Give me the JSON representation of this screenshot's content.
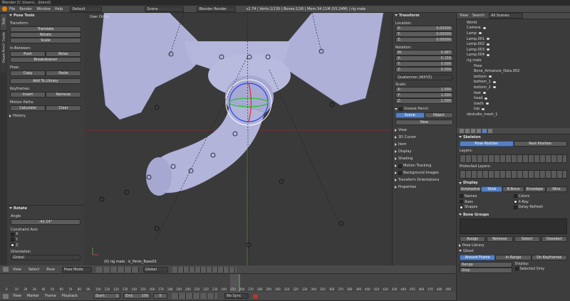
{
  "titlebar": {
    "text": "Blender [C:\\Users\\...\\blend]"
  },
  "topbar": {
    "menus": [
      "File",
      "Render",
      "Window",
      "Help"
    ],
    "layout": "Default",
    "scene": "Scene",
    "engine": "Blender Render",
    "stats": "v2.74 | Verts:1/130 | Bones:1/26 | Mem:34.11M (55.24M) | rig male"
  },
  "toolshelf": {
    "tabs": [
      "Tools",
      "Create",
      "Grease Pencil"
    ],
    "title": "Pose Tools",
    "transform_label": "Transform:",
    "translate": "Translate",
    "rotate": "Rotate",
    "scale": "Scale",
    "inbetweens_label": "In-Between:",
    "push": "Push",
    "relax": "Relax",
    "breakdowner": "Breakdowner",
    "pose_label": "Pose:",
    "copy": "Copy",
    "paste": "Paste",
    "add_to_library": "Add To Library",
    "keyframes_label": "Keyframes:",
    "insert": "Insert",
    "remove": "Remove",
    "motion_paths_label": "Motion Paths:",
    "calculate": "Calculate",
    "clear": "Clear",
    "history": "History"
  },
  "operator": {
    "title": "Rotate",
    "angle_label": "Angle",
    "angle_value": "-42.24°",
    "constraint_label": "Constraint Axis",
    "x": "X",
    "y": "Y",
    "z": "Z",
    "orientation_label": "Orientation",
    "orientation_value": "Global"
  },
  "viewport": {
    "view_name": "User Ortho",
    "status": "(0) rig male : b_Penis_Base01"
  },
  "nprops": {
    "transform_title": "Transform",
    "location_label": "Location:",
    "loc": [
      [
        "X:",
        "0.00000"
      ],
      [
        "Y:",
        "0.00000"
      ],
      [
        "Z:",
        "0.00000"
      ]
    ],
    "rotation_label": "Rotation:",
    "rot": [
      [
        "W:",
        "0.987"
      ],
      [
        "X:",
        "0.159"
      ],
      [
        "Y:",
        "0.000"
      ],
      [
        "Z:",
        "0.000"
      ]
    ],
    "rot_mode": "Quaternion (WXYZ)",
    "scale_label": "Scale:",
    "scl": [
      [
        "X:",
        "1.000"
      ],
      [
        "Y:",
        "1.000"
      ],
      [
        "Z:",
        "1.000"
      ]
    ],
    "grease_pencil": "Grease Pencil",
    "gp_scene": "Scene",
    "gp_object": "Object",
    "gp_new": "New",
    "sections": [
      "View",
      "3D Cursor",
      "Item",
      "Display",
      "Shading",
      "Motion Tracking",
      "Background Images",
      "Transform Orientations",
      "Properties"
    ]
  },
  "outliner": {
    "header": [
      "View",
      "Search",
      "All Scenes"
    ],
    "items": [
      "World",
      "Camera",
      "Lamp",
      "Lamp.001",
      "Lamp.002",
      "Lamp.003",
      "Lamp.004",
      "rig male",
      "Pose",
      "Bone_Armature_Data.002",
      "bottom",
      "bottom_1",
      "bottom_2",
      "feet",
      "head",
      "lowth",
      "top",
      "obstudio_mesh_1"
    ]
  },
  "properties": {
    "skeleton": "Skeleton",
    "pose_position": "Pose Position",
    "rest_position": "Rest Position",
    "layers": "Layers:",
    "protected_layers": "Protected Layers:",
    "display": "Display",
    "display_tabs": [
      "Octahedral",
      "Stick",
      "B-Bone",
      "Envelope",
      "Wire"
    ],
    "names": "Names",
    "colors": "Colors",
    "axes": "Axes",
    "xray": "X-Ray",
    "shapes": "Shapes",
    "delay_refresh": "Delay Refresh",
    "bone_groups": "Bone Groups",
    "assign": "Assign",
    "remove": "Remove",
    "select": "Select",
    "deselect": "Deselect",
    "pose_library": "Pose Library",
    "ghost": "Ghost",
    "ghost_tabs": [
      "Around Frame",
      "In Range",
      "On Keyframes"
    ],
    "range": "Range",
    "step": "Step",
    "display2": "Display:",
    "selected_only": "Selected Only"
  },
  "view3d_header": {
    "menus": [
      "View",
      "Select",
      "Pose"
    ],
    "mode": "Pose Mode",
    "pivot": "Global"
  },
  "timeline": {
    "menus": [
      "View",
      "Marker",
      "Frame",
      "Playback"
    ],
    "start_label": "Start:",
    "start": "1",
    "end_label": "End:",
    "end": "100",
    "current": "0",
    "sync": "No Sync",
    "ticks": [
      "0",
      "10",
      "20",
      "30",
      "40",
      "50",
      "60",
      "70",
      "80",
      "90",
      "100",
      "110",
      "120",
      "130",
      "140",
      "150",
      "160",
      "170",
      "180",
      "190",
      "200",
      "210",
      "220",
      "230",
      "240",
      "250",
      "260",
      "270",
      "280",
      "290",
      "300",
      "310",
      "320",
      "330",
      "340",
      "350",
      "360",
      "370",
      "380",
      "390",
      "400",
      "410",
      "420",
      "430",
      "440",
      "450",
      "460",
      "470",
      "480",
      "490",
      "500"
    ]
  },
  "colors": {
    "accent": "#5680c2",
    "bg": "#393939",
    "mesh": "#aeb0d8"
  }
}
